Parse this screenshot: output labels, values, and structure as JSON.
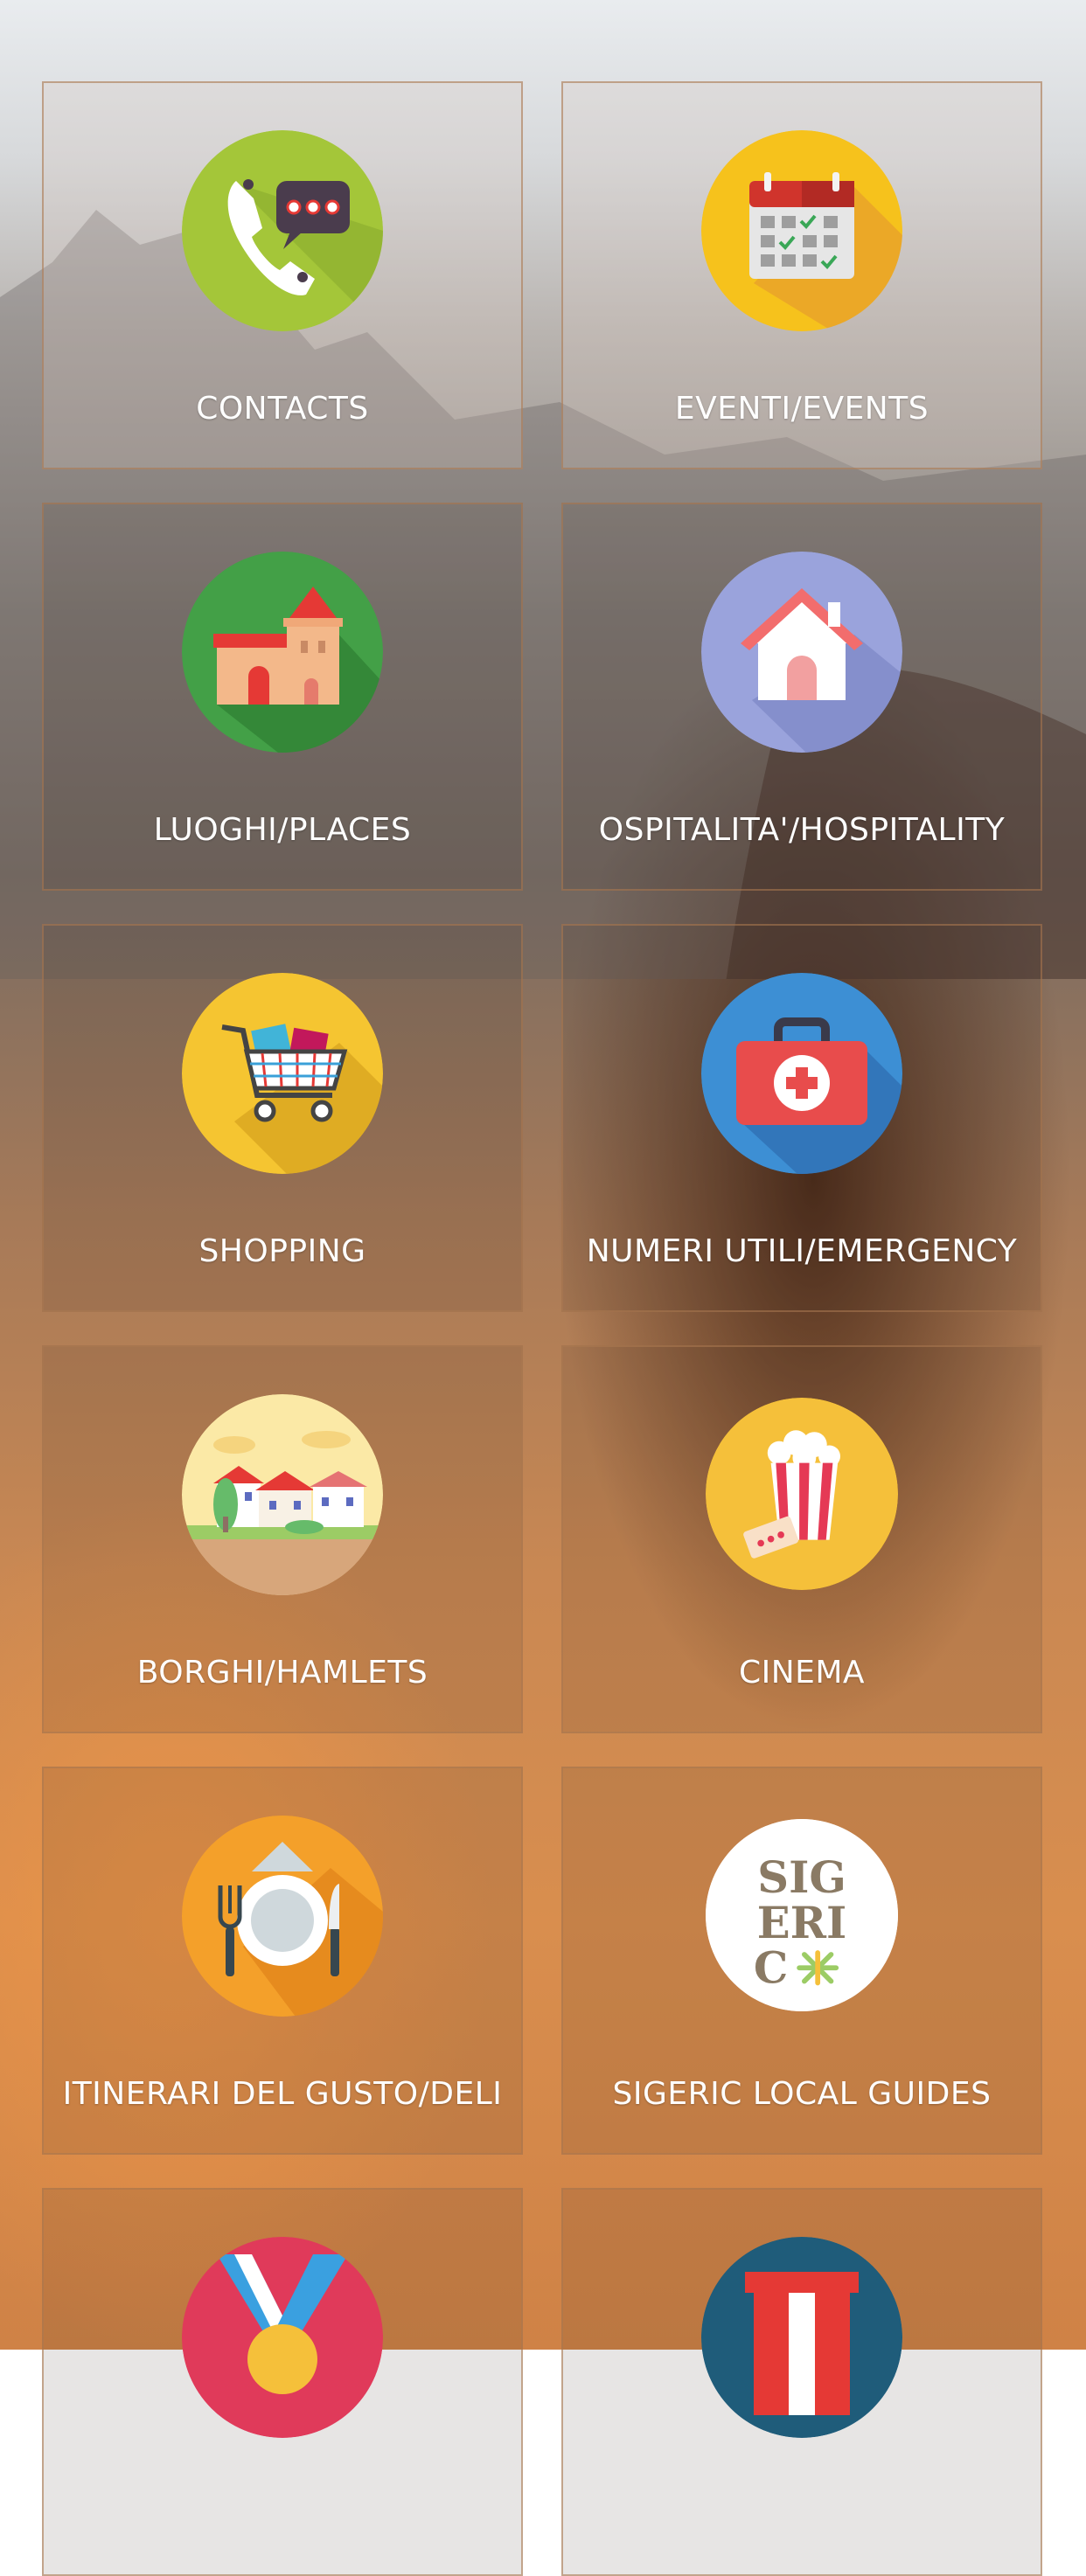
{
  "tiles": [
    {
      "label": "CONTACTS",
      "icon": "phone-chat-icon"
    },
    {
      "label": "EVENTI/EVENTS",
      "icon": "calendar-icon"
    },
    {
      "label": "LUOGHI/PLACES",
      "icon": "castle-icon"
    },
    {
      "label": "OSPITALITA'/HOSPITALITY",
      "icon": "house-icon"
    },
    {
      "label": "SHOPPING",
      "icon": "shopping-cart-icon"
    },
    {
      "label": "NUMERI UTILI/EMERGENCY",
      "icon": "first-aid-kit-icon"
    },
    {
      "label": "BORGHI/HAMLETS",
      "icon": "village-icon"
    },
    {
      "label": "CINEMA",
      "icon": "popcorn-icon"
    },
    {
      "label": "ITINERARI DEL GUSTO/DELI",
      "icon": "plate-cutlery-icon"
    },
    {
      "label": "SIGERIC LOCAL GUIDES",
      "icon": "sigeric-logo-icon",
      "logo_text": [
        "SIG",
        "ERI",
        "C"
      ]
    },
    {
      "label": "",
      "icon": "medal-icon"
    },
    {
      "label": "",
      "icon": "theater-curtain-icon"
    }
  ],
  "colors": {
    "tile_border": "#b58a66",
    "label": "#ffffff"
  }
}
